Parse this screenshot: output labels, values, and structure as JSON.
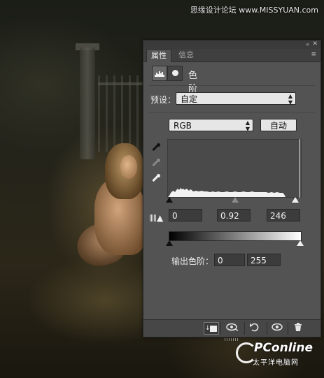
{
  "watermark": {
    "top_text": "思缘设计论坛 www.MISSYUAN.com",
    "logo_text": "PConline",
    "logo_sub": "太平洋电脑网"
  },
  "panel": {
    "tabs": [
      {
        "label": "属性",
        "active": true
      },
      {
        "label": "信息",
        "active": false
      }
    ],
    "icons": {
      "collapse": "«",
      "close": "✕",
      "menu": "≡"
    },
    "title": "色阶",
    "preset": {
      "label": "预设：",
      "value": "自定"
    },
    "channel": {
      "value": "RGB"
    },
    "auto_button": "自动",
    "input_levels": {
      "black": "0",
      "gamma": "0.92",
      "white": "246"
    },
    "output_levels": {
      "label": "输出色阶：",
      "black": "0",
      "white": "255"
    }
  },
  "colors": {
    "panel_bg": "#535353",
    "arrow": "#d01818"
  }
}
